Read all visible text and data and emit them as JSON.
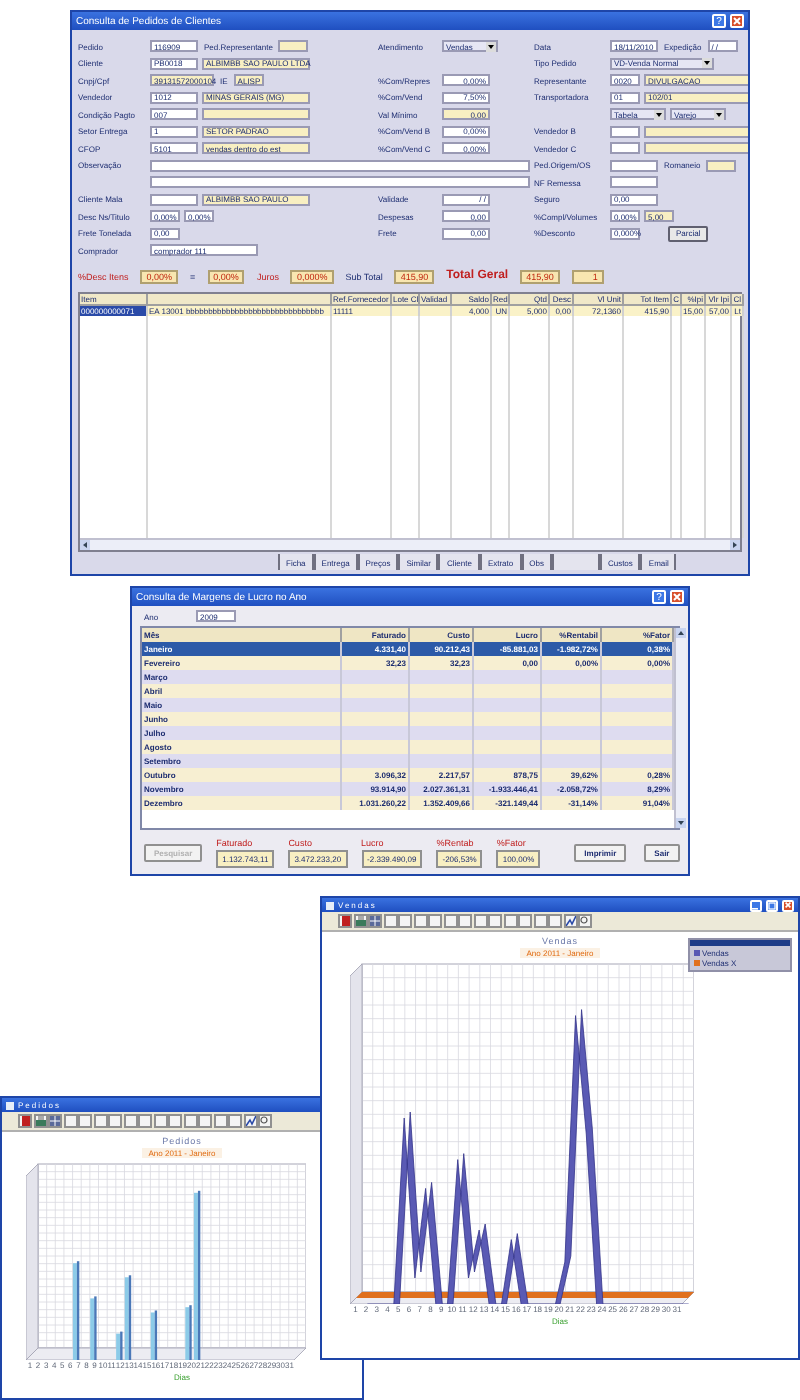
{
  "order_window": {
    "title": "Consulta de Pedidos de Clientes",
    "help": "?",
    "left": [
      {
        "label": "Pedido",
        "fields": [
          {
            "kind": "code",
            "readonly": false,
            "value": "116909"
          },
          {
            "kind": "label",
            "value": "Ped.Representante"
          },
          {
            "kind": "short",
            "readonly": true
          }
        ]
      },
      {
        "label": "Cliente",
        "fields": [
          {
            "kind": "code",
            "readonly": false,
            "value": "PB0018"
          },
          {
            "kind": "name",
            "readonly": true,
            "value": "ALBIMBB SAO PAULO LTDA"
          }
        ]
      },
      {
        "label": "Cnpj/Cpf",
        "fields": [
          {
            "kind": "doc",
            "readonly": true,
            "value": "39131572000104"
          },
          {
            "kind": "label",
            "value": "IE"
          },
          {
            "kind": "short",
            "readonly": true,
            "value": "ALISP"
          }
        ]
      },
      {
        "label": "Vendedor",
        "fields": [
          {
            "kind": "code",
            "readonly": false,
            "value": "1012"
          },
          {
            "kind": "name",
            "readonly": true,
            "value": "MINAS GERAIS (MG)"
          }
        ]
      },
      {
        "label": "Condição Pagto",
        "fields": [
          {
            "kind": "code",
            "readonly": false,
            "value": "007"
          },
          {
            "kind": "name",
            "readonly": true
          }
        ]
      },
      {
        "label": "Setor Entrega",
        "fields": [
          {
            "kind": "code",
            "readonly": false,
            "value": "1"
          },
          {
            "kind": "name",
            "readonly": true,
            "value": "SETOR PADRAO"
          }
        ]
      },
      {
        "label": "CFOP",
        "fields": [
          {
            "kind": "code",
            "readonly": false,
            "value": "5101"
          },
          {
            "kind": "name",
            "readonly": true,
            "value": "vendas dentro do est"
          }
        ]
      },
      {
        "label": "Observação",
        "fields": [
          {
            "kind": "memo",
            "readonly": false
          }
        ]
      },
      {
        "fields": [
          {
            "kind": "memo",
            "readonly": false
          }
        ]
      },
      {
        "label": "Cliente Mala",
        "fields": [
          {
            "kind": "code",
            "readonly": false
          },
          {
            "kind": "name",
            "readonly": true,
            "value": "ALBIMBB SAO PAULO"
          }
        ]
      },
      {
        "label": "Desc Ns/Titulo",
        "fields": [
          {
            "kind": "short",
            "readonly": false,
            "value": "0,00%"
          },
          {
            "kind": "short",
            "readonly": false,
            "value": "0,00%"
          }
        ]
      },
      {
        "label": "Frete Tonelada",
        "fields": [
          {
            "kind": "short",
            "readonly": false,
            "value": "0,00"
          }
        ]
      },
      {
        "label": "Comprador",
        "fields": [
          {
            "kind": "name",
            "readonly": false,
            "value": "comprador 111"
          }
        ]
      }
    ],
    "middle": [
      {
        "label": "Atendimento",
        "fields": [
          {
            "kind": "select",
            "value": "Vendas"
          }
        ]
      },
      {
        "label": "%Com/Repres",
        "fields": [
          {
            "kind": "num",
            "readonly": false,
            "value": "0,00%"
          }
        ]
      },
      {
        "label": "%Com/Vend",
        "fields": [
          {
            "kind": "num",
            "readonly": false,
            "value": "7,50%"
          }
        ]
      },
      {
        "label": "Val Mínimo",
        "fields": [
          {
            "kind": "num",
            "readonly": true,
            "value": "0,00"
          }
        ]
      },
      {
        "label": "%Com/Vend B",
        "fields": [
          {
            "kind": "num",
            "readonly": false,
            "value": "0,00%"
          }
        ]
      },
      {
        "label": "%Com/Vend C",
        "fields": [
          {
            "kind": "num",
            "readonly": false,
            "value": "0,00%"
          }
        ]
      },
      {
        "label": "Validade",
        "fields": [
          {
            "kind": "num",
            "readonly": false,
            "value": "/ /"
          }
        ]
      },
      {
        "label": "Despesas",
        "fields": [
          {
            "kind": "num",
            "readonly": false,
            "value": "0,00"
          }
        ]
      },
      {
        "label": "Frete",
        "fields": [
          {
            "kind": "num",
            "readonly": false,
            "value": "0,00"
          }
        ]
      }
    ],
    "right": [
      {
        "label": "Data",
        "fields": [
          {
            "kind": "code",
            "readonly": false,
            "value": "18/11/2010"
          },
          {
            "kind": "label",
            "value": "Expedição"
          },
          {
            "kind": "short",
            "readonly": false,
            "value": "/ /"
          }
        ]
      },
      {
        "label": "Tipo Pedido",
        "fields": [
          {
            "kind": "combo",
            "value": "VD-Venda Normal"
          }
        ]
      },
      {
        "label": "Representante",
        "fields": [
          {
            "kind": "short",
            "readonly": false,
            "value": "0020"
          },
          {
            "kind": "name",
            "readonly": true,
            "value": "DIVULGACAO"
          }
        ]
      },
      {
        "label": "Transportadora",
        "fields": [
          {
            "kind": "short",
            "readonly": false,
            "value": "01"
          },
          {
            "kind": "name",
            "readonly": true,
            "value": "102/01"
          }
        ]
      },
      {
        "fields": [
          {
            "kind": "select",
            "value": "Tabela"
          },
          {
            "kind": "select",
            "value": "Varejo"
          }
        ]
      },
      {
        "label": "Vendedor B",
        "fields": [
          {
            "kind": "short",
            "readonly": false
          },
          {
            "kind": "name",
            "readonly": true
          }
        ]
      },
      {
        "label": "Vendedor C",
        "fields": [
          {
            "kind": "short",
            "readonly": false
          },
          {
            "kind": "name",
            "readonly": true
          }
        ]
      },
      {
        "label": "Ped.Origem/OS",
        "fields": [
          {
            "kind": "code",
            "readonly": false
          },
          {
            "kind": "label",
            "value": "Romaneio"
          },
          {
            "kind": "short",
            "readonly": true
          }
        ]
      },
      {
        "label": "NF Remessa",
        "fields": [
          {
            "kind": "code",
            "readonly": false
          }
        ]
      },
      {
        "label": "Seguro",
        "fields": [
          {
            "kind": "code",
            "readonly": false,
            "value": "0,00"
          }
        ]
      },
      {
        "label": "%Compl/Volumes",
        "fields": [
          {
            "kind": "short",
            "readonly": false,
            "value": "0,00%"
          },
          {
            "kind": "short",
            "readonly": true,
            "value": "5,00"
          }
        ]
      },
      {
        "label": "%Desconto",
        "fields": [
          {
            "kind": "short",
            "readonly": false,
            "value": "0,000%"
          },
          {
            "kind": "button",
            "value": "Parcial"
          }
        ]
      }
    ],
    "totals": [
      {
        "kind": "label",
        "value": "%Desc Itens"
      },
      {
        "kind": "field",
        "value": "0,00%"
      },
      {
        "kind": "text",
        "value": "="
      },
      {
        "kind": "field",
        "value": "0,00%"
      },
      {
        "kind": "label",
        "value": "Juros"
      },
      {
        "kind": "field",
        "value": "0,000%"
      },
      {
        "kind": "text",
        "value": "Sub Total"
      },
      {
        "kind": "field",
        "value": "415,90"
      },
      {
        "kind": "total",
        "value": "Total Geral"
      },
      {
        "kind": "field",
        "value": "415,90"
      },
      {
        "kind": "field",
        "value": "1"
      }
    ],
    "table": {
      "columns": [
        {
          "label": "Item"
        },
        {},
        {
          "label": "Ref.Fornecedor"
        },
        {
          "label": "Lote Cl"
        },
        {
          "label": "Validad"
        },
        {
          "label": "Saldo"
        },
        {
          "label": "Red"
        },
        {
          "label": "Qtd"
        },
        {
          "label": "Desc"
        },
        {
          "label": "Vl Unit"
        },
        {
          "label": "Tot Item"
        },
        {
          "label": "C"
        },
        {
          "label": "%Ipi"
        },
        {
          "label": "Vlr Ipi"
        },
        {
          "label": "Cl"
        }
      ],
      "rows": [
        {
          "selected": true,
          "cells": [
            "000000000071",
            "EA 13001 bbbbbbbbbbbbbbbbbbbbbbbbbbbbbbb",
            "11111",
            null,
            null,
            "4,000",
            "UN",
            "5,000",
            "0,00",
            "72,1360",
            "415,90",
            null,
            "15,00",
            "57,00",
            "Lt"
          ]
        }
      ]
    },
    "buttons": [
      {
        "label": "Ficha"
      },
      {
        "label": "Entrega"
      },
      {
        "label": "Preços"
      },
      {
        "label": "Similar"
      },
      {
        "label": "Cliente"
      },
      {
        "label": "Extrato"
      },
      {
        "label": "Obs"
      },
      {
        "label": "Custos"
      },
      {
        "label": "Email"
      }
    ]
  },
  "margin_window": {
    "title": "Consulta de Margens de Lucro no Ano",
    "help": "?",
    "year_label": "Ano",
    "year": "2009",
    "columns": [
      "Mês",
      "Faturado",
      "Custo",
      "Lucro",
      "%Rentabil",
      "%Fator"
    ],
    "rows": [
      {
        "selected": true,
        "cells": [
          "Janeiro",
          "4.331,40",
          "90.212,43",
          "-85.881,03",
          "-1.982,72%",
          "0,38%"
        ]
      },
      {
        "selected": false,
        "cells": [
          "Fevereiro",
          "32,23",
          "32,23",
          "0,00",
          "0,00%",
          "0,00%"
        ]
      },
      {
        "selected": false,
        "cells": [
          "Março"
        ]
      },
      {
        "selected": false,
        "cells": [
          "Abril"
        ]
      },
      {
        "selected": false,
        "cells": [
          "Maio"
        ]
      },
      {
        "selected": false,
        "cells": [
          "Junho"
        ]
      },
      {
        "selected": false,
        "cells": [
          "Julho"
        ]
      },
      {
        "selected": false,
        "cells": [
          "Agosto"
        ]
      },
      {
        "selected": false,
        "cells": [
          "Setembro"
        ]
      },
      {
        "selected": false,
        "cells": [
          "Outubro",
          "3.096,32",
          "2.217,57",
          "878,75",
          "39,62%",
          "0,28%"
        ]
      },
      {
        "selected": false,
        "cells": [
          "Novembro",
          "93.914,90",
          "2.027.361,31",
          "-1.933.446,41",
          "-2.058,72%",
          "8,29%"
        ]
      },
      {
        "selected": false,
        "cells": [
          "Dezembro",
          "1.031.260,22",
          "1.352.409,66",
          "-321.149,44",
          "-31,14%",
          "91,04%"
        ]
      }
    ],
    "search_button": {
      "label": "Pesquisar",
      "disabled": true
    },
    "totals": [
      {
        "label": "Faturado",
        "value": "1.132.743,11"
      },
      {
        "label": "Custo",
        "value": "3.472.233,20"
      },
      {
        "label": "Lucro",
        "value": "-2.339.490,09"
      },
      {
        "label": "%Rentab",
        "value": "-206,53%"
      },
      {
        "label": "%Fator",
        "value": "100,00%"
      }
    ],
    "buttons": [
      {
        "label": "Imprimir",
        "disabled": false
      },
      {
        "label": "Sair",
        "disabled": false
      }
    ]
  },
  "sales_chart_window": {
    "title": "Vendas",
    "chart_title": "Vendas",
    "subtitle": "Ano 2011 - Janeiro",
    "xlabel": "Dias",
    "legend": [
      {
        "label": "Vendas",
        "color": "#5a5ab4"
      },
      {
        "label": "Vendas X",
        "color": "#e0701e"
      }
    ],
    "day_labels": [
      "1",
      "2",
      "3",
      "4",
      "5",
      "6",
      "7",
      "8",
      "9",
      "10",
      "11",
      "12",
      "13",
      "14",
      "15",
      "16",
      "17",
      "18",
      "19",
      "20",
      "21",
      "22",
      "23",
      "24",
      "25",
      "26",
      "27",
      "28",
      "29",
      "30",
      "31"
    ]
  },
  "orders_chart_window": {
    "title": "Pedidos",
    "chart_title": "Pedidos",
    "subtitle": "Ano 2011 - Janeiro",
    "xlabel": "Dias",
    "day_labels": [
      "1",
      "2",
      "3",
      "4",
      "5",
      "6",
      "7",
      "8",
      "9",
      "10",
      "11",
      "12",
      "13",
      "14",
      "15",
      "16",
      "17",
      "18",
      "19",
      "20",
      "21",
      "22",
      "23",
      "24",
      "25",
      "26",
      "27",
      "28",
      "29",
      "30",
      "31"
    ]
  }
}
